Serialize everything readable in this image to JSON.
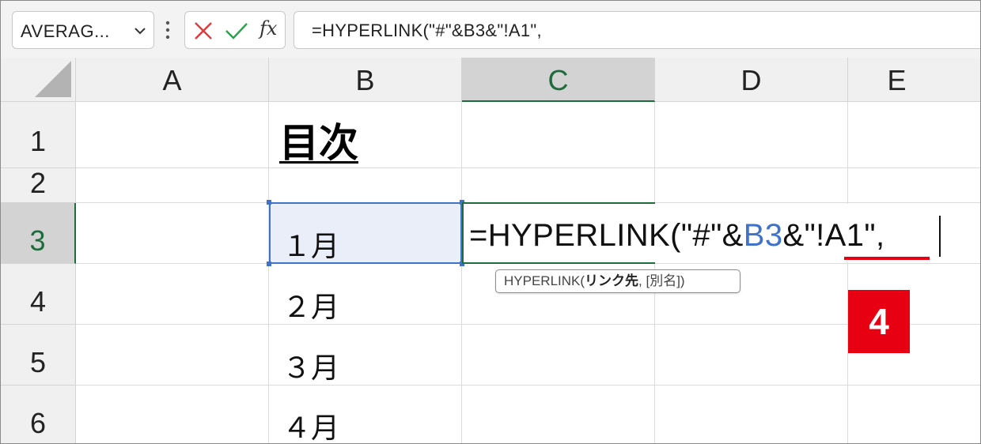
{
  "name_box": {
    "value": "AVERAG..."
  },
  "formula_bar": {
    "cancel_icon": "x-icon",
    "enter_icon": "check-icon",
    "fx_label": "fx",
    "formula": "=HYPERLINK(\"#\"&B3&\"!A1\","
  },
  "columns": [
    "A",
    "B",
    "C",
    "D",
    "E"
  ],
  "rows": [
    "1",
    "2",
    "3",
    "4",
    "5",
    "6"
  ],
  "active": {
    "column": "C",
    "row": "3"
  },
  "cells": {
    "B1": "目次",
    "B3": "１月",
    "B4": "２月",
    "B5": "３月",
    "B6": "４月"
  },
  "in_cell_edit": {
    "part1": "=HYPERLINK(\"#\"&",
    "ref": "B3",
    "part2": "&\"!A1\","
  },
  "tooltip": {
    "func": "HYPERLINK(",
    "arg_bold": "リンク先",
    "rest": ", [別名])"
  },
  "step_badge": "4",
  "colors": {
    "accent_green": "#1e6b3c",
    "reference_blue": "#3f72c9",
    "badge_red": "#e60012"
  }
}
